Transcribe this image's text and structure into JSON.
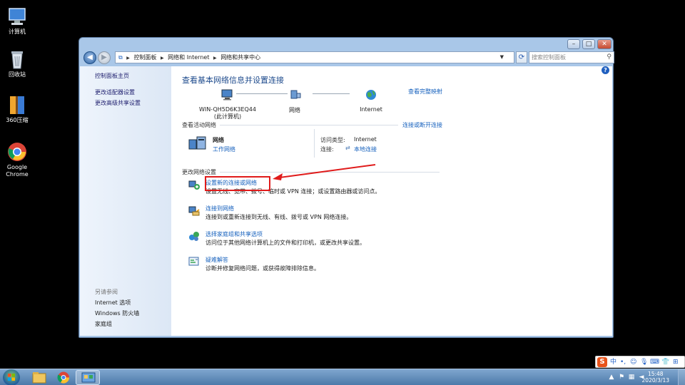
{
  "desktop": {
    "icons": [
      {
        "label": "计算机"
      },
      {
        "label": "回收站"
      },
      {
        "label": "360压缩"
      },
      {
        "label": "Google Chrome"
      }
    ]
  },
  "window": {
    "controls": {
      "minimize": "–",
      "maximize": "□",
      "close": "✕"
    },
    "nav": {
      "back": "◀",
      "forward": "▶"
    },
    "address": {
      "crumbs": [
        "控制面板",
        "网络和 Internet",
        "网络和共享中心"
      ]
    },
    "search": {
      "placeholder": "搜索控制面板"
    },
    "help_label": "?",
    "sidebar": {
      "home": "控制面板主页",
      "links": [
        "更改适配器设置",
        "更改高级共享设置"
      ],
      "see_also": "另请参阅",
      "see_also_items": [
        "Internet 选项",
        "Windows 防火墙",
        "家庭组"
      ]
    },
    "main": {
      "title": "查看基本网络信息并设置连接",
      "full_map": "查看完整映射",
      "map": {
        "computer_name": "WIN-QH5D6K3EQ44",
        "computer_sub": "(此计算机)",
        "network": "网络",
        "internet": "Internet"
      },
      "active_networks": {
        "heading": "查看活动网络",
        "connect_link": "连接或断开连接",
        "name": "网络",
        "type": "工作网络",
        "access_label": "访问类型:",
        "access_value": "Internet",
        "connection_label": "连接:",
        "connection_value": "本地连接"
      },
      "change_settings": {
        "heading": "更改网络设置",
        "tasks": [
          {
            "title": "设置新的连接或网络",
            "desc": "设置无线、宽带、拨号、临时或 VPN 连接；或设置路由器或访问点。"
          },
          {
            "title": "连接到网络",
            "desc": "连接到或重新连接到无线、有线、拨号或 VPN 网络连接。"
          },
          {
            "title": "选择家庭组和共享选项",
            "desc": "访问位于其他网络计算机上的文件和打印机，或更改共享设置。"
          },
          {
            "title": "疑难解答",
            "desc": "诊断并修复网络问题，或获得故障排除信息。"
          }
        ]
      }
    }
  },
  "ime": {
    "lang": "中",
    "punct": "•,"
  },
  "taskbar": {
    "time": "15:48",
    "date": "2020/3/13"
  },
  "colors": {
    "link": "#1560bd",
    "title": "#1d4a8c",
    "highlight_box": "#e01b1b",
    "taskbar": "#5b86b5"
  }
}
